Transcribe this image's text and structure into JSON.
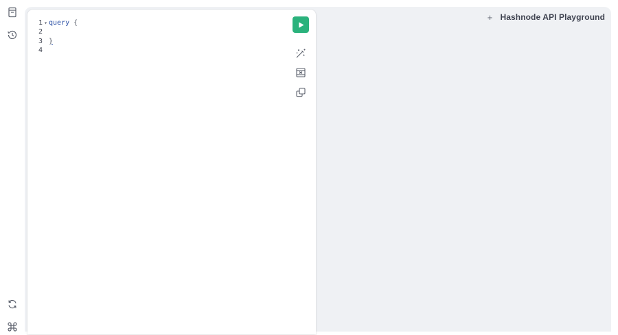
{
  "sidebar": {
    "top_icons": [
      {
        "name": "docs-icon"
      },
      {
        "name": "history-icon"
      }
    ],
    "bottom_icons": [
      {
        "name": "refetch-schema-icon"
      },
      {
        "name": "shortcuts-icon"
      }
    ]
  },
  "editor": {
    "lines": [
      {
        "number": "1",
        "fold": "▾",
        "keyword": "query",
        "rest": " {"
      },
      {
        "number": "2",
        "fold": "",
        "keyword": "",
        "rest": ""
      },
      {
        "number": "3",
        "fold": "",
        "keyword": "",
        "rest": "}"
      },
      {
        "number": "4",
        "fold": "",
        "keyword": "",
        "rest": ""
      }
    ]
  },
  "toolbar": {
    "run_icon": "play-icon",
    "prettify_icon": "magic-wand-icon",
    "merge_icon": "merge-fragments-icon",
    "copy_icon": "copy-icon"
  },
  "session": {
    "add_tab_label": "+",
    "title": "Hashnode API Playground"
  },
  "colors": {
    "run_button": "#2bb27c",
    "background": "#eff1f4",
    "keyword": "#2a4fa5"
  }
}
